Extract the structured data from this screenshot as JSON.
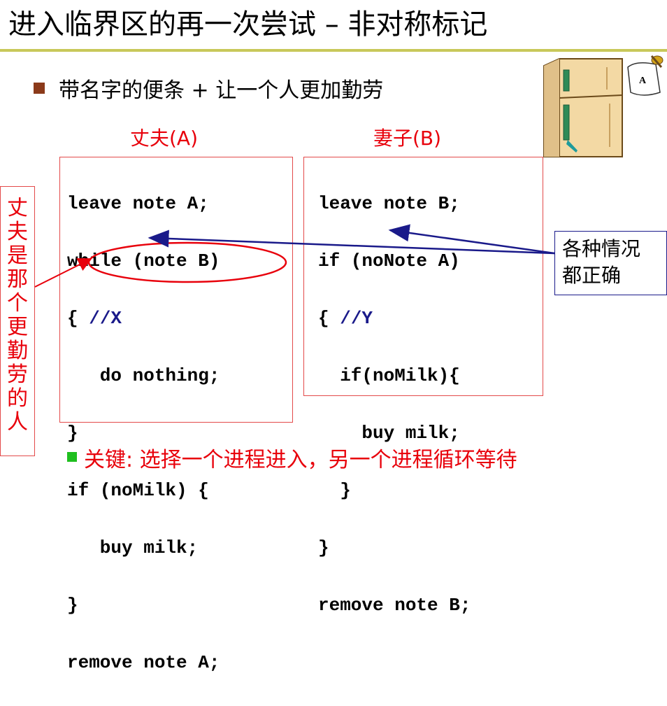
{
  "slide": {
    "title": "进入临界区的再一次尝试 – 非对称标记",
    "bullet": "带名字的便条 + 让一个人更加勤劳",
    "husband": {
      "label": "丈夫(A)",
      "code": [
        "leave note A;",
        "while (note B)",
        "{ //X",
        "   do nothing;",
        "}",
        "if (noMilk) {",
        "   buy milk;",
        "}",
        "remove note A;"
      ]
    },
    "wife": {
      "label": "妻子(B)",
      "code": [
        "leave note B;",
        "if (noNote A)",
        "{ //Y",
        "  if(noMilk){",
        "    buy milk;",
        "  }",
        "}",
        "remove note B;"
      ]
    },
    "side_label": "丈夫是那个更勤劳的人",
    "callout": "各种情况都正确",
    "fridge_note": "A",
    "bottom_bullet": "关键: 选择一个进程进入，另一个进程循环等待"
  },
  "colors": {
    "accent_red": "#e8000b",
    "callout_blue": "#1a1a8a",
    "title_rule": "#c8c85a",
    "bullet_brown": "#8b3a1a",
    "bullet_green": "#1fbf1f"
  },
  "icons": [
    "fridge-icon",
    "note-icon"
  ]
}
